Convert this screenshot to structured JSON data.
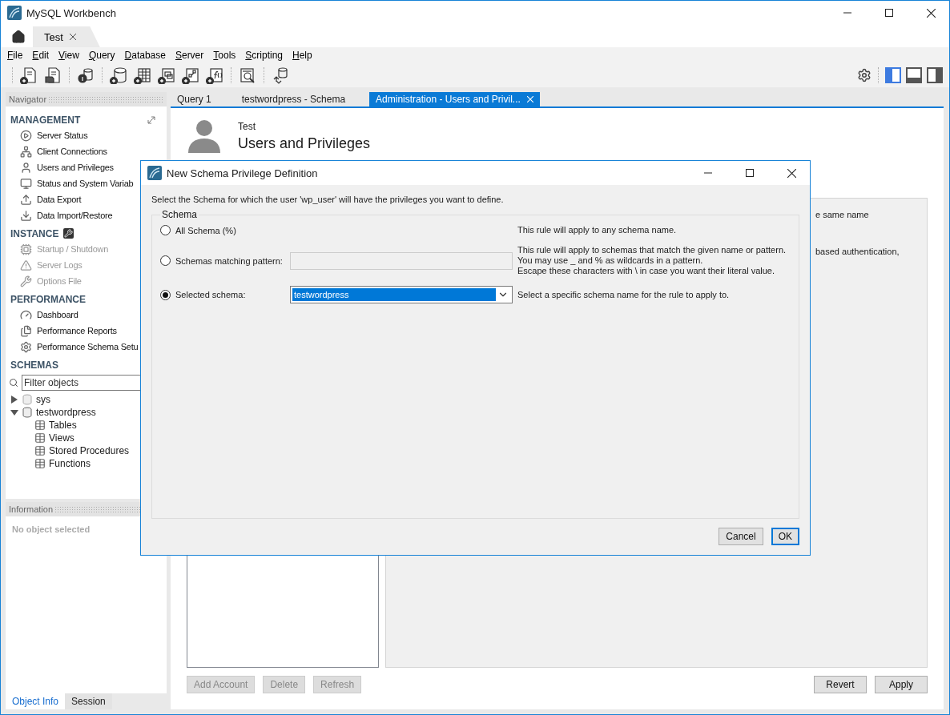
{
  "window": {
    "title": "MySQL Workbench"
  },
  "connection_tabs": [
    {
      "label": "Test",
      "selected": true
    }
  ],
  "menu": [
    "File",
    "Edit",
    "View",
    "Query",
    "Database",
    "Server",
    "Tools",
    "Scripting",
    "Help"
  ],
  "panel_toggles": [
    {
      "on": true
    },
    {
      "on": false
    },
    {
      "on": false
    }
  ],
  "navigator": {
    "title": "Navigator",
    "sections": [
      {
        "title": "MANAGEMENT",
        "items": [
          {
            "label": "Server Status",
            "disabled": false
          },
          {
            "label": "Client Connections",
            "disabled": false
          },
          {
            "label": "Users and Privileges",
            "disabled": false
          },
          {
            "label": "Status and System Variab",
            "disabled": false
          },
          {
            "label": "Data Export",
            "disabled": false
          },
          {
            "label": "Data Import/Restore",
            "disabled": false
          }
        ]
      },
      {
        "title": "INSTANCE",
        "items": [
          {
            "label": "Startup / Shutdown",
            "disabled": true
          },
          {
            "label": "Server Logs",
            "disabled": true
          },
          {
            "label": "Options File",
            "disabled": true
          }
        ]
      },
      {
        "title": "PERFORMANCE",
        "items": [
          {
            "label": "Dashboard",
            "disabled": false
          },
          {
            "label": "Performance Reports",
            "disabled": false
          },
          {
            "label": "Performance Schema Setu",
            "disabled": false
          }
        ]
      }
    ],
    "schemas": {
      "title": "SCHEMAS",
      "filter_placeholder": "Filter objects",
      "tree": [
        {
          "label": "sys",
          "expanded": false
        },
        {
          "label": "testwordpress",
          "expanded": true,
          "children": [
            {
              "label": "Tables"
            },
            {
              "label": "Views"
            },
            {
              "label": "Stored Procedures"
            },
            {
              "label": "Functions"
            }
          ]
        }
      ]
    }
  },
  "information": {
    "title": "Information",
    "message": "No object selected"
  },
  "bottom_tabs": [
    {
      "label": "Object Info",
      "selected": true
    },
    {
      "label": "Session",
      "selected": false
    }
  ],
  "editor_tabs": [
    {
      "label": "Query 1",
      "selected": false,
      "closable": false
    },
    {
      "label": "testwordpress - Schema",
      "selected": false,
      "closable": false
    },
    {
      "label": "Administration - Users and Privil...",
      "selected": true,
      "closable": true
    }
  ],
  "page": {
    "connection": "Test",
    "title": "Users and Privileges",
    "right_panel_texts": [
      "e same name",
      "based authentication,"
    ],
    "left_buttons": [
      {
        "label": "Add Account",
        "disabled": true
      },
      {
        "label": "Delete",
        "disabled": true
      },
      {
        "label": "Refresh",
        "disabled": true
      }
    ],
    "right_buttons": [
      {
        "label": "Revert",
        "disabled": false
      },
      {
        "label": "Apply",
        "disabled": false
      }
    ]
  },
  "dialog": {
    "title": "New Schema Privilege Definition",
    "instruction": "Select the Schema for which the user 'wp_user' will have the privileges you want to define.",
    "group_title": "Schema",
    "options": [
      {
        "label": "All Schema (%)",
        "selected": false,
        "kind": "none",
        "description": [
          "This rule will apply to any schema name."
        ]
      },
      {
        "label": "Schemas matching pattern:",
        "selected": false,
        "kind": "text",
        "description": [
          "This rule will apply to schemas that match the given name or pattern.",
          "You may use _ and % as wildcards in a pattern.",
          "Escape these characters with \\ in case you want their literal value."
        ]
      },
      {
        "label": "Selected schema:",
        "selected": true,
        "kind": "select",
        "value": "testwordpress",
        "description": [
          "Select a specific schema name for the rule to apply to."
        ]
      }
    ],
    "buttons": [
      {
        "label": "Cancel",
        "default": false
      },
      {
        "label": "OK",
        "default": true
      }
    ]
  }
}
